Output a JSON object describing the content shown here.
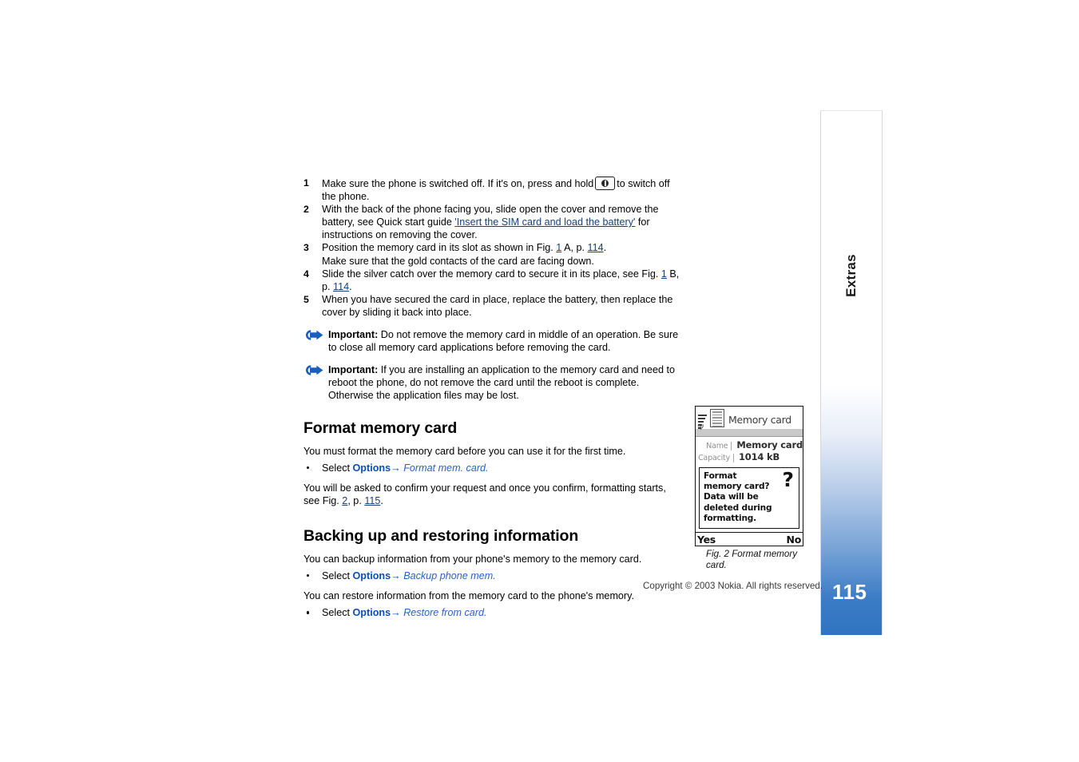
{
  "page": {
    "copyright": "Copyright © 2003 Nokia. All rights reserved."
  },
  "sidebar": {
    "chapter_label": "Extras",
    "page_number": "115",
    "accent_color": "#2f74c0"
  },
  "steps": [
    {
      "number": "1",
      "text_before_key": "Make sure the phone is switched off. If it's on, press and hold",
      "key_icon": "power-key-icon",
      "text_after_key": "to switch off the phone."
    },
    {
      "number": "2",
      "part1": "With the back of the phone facing you, slide open the cover and remove the battery, see Quick start guide ",
      "link": "'Insert the SIM card and load the battery'",
      "part2": " for instructions on removing the cover."
    },
    {
      "number": "3",
      "part1": "Position the memory card in its slot as shown in Fig. ",
      "fig_link": "1",
      "part2": " A, p. ",
      "page_link": "114",
      "part3": ".",
      "subline": "Make sure that the gold contacts of the card are facing down."
    },
    {
      "number": "4",
      "part1": "Slide the silver catch over the memory card to secure it in its place, see Fig. ",
      "fig_link": "1",
      "part2": " B, p. ",
      "page_link": "114",
      "part3": "."
    },
    {
      "number": "5",
      "part1": "When you have secured the card in place, replace the battery, then replace the cover by sliding it back into place."
    }
  ],
  "notes": [
    {
      "icon": "important-arrow-icon",
      "label": "Important:",
      "text": " Do not remove the memory card in middle of an operation. Be sure to close all memory card applications before removing the card."
    },
    {
      "icon": "important-arrow-icon",
      "label": "Important:",
      "text": " If you are installing an application to the memory card and need to reboot the phone, do not remove the card until the reboot is complete. Otherwise the application files may be lost."
    }
  ],
  "section_format": {
    "heading": "Format memory card",
    "intro": "You must format the memory card before you can use it for the first time.",
    "bullet": {
      "select_word": "Select",
      "menu": "Options",
      "arrow": "→",
      "command": "Format mem. card."
    },
    "outro_part1": "You will be asked to confirm your request and once you confirm, formatting starts, see Fig. ",
    "outro_fig_link": "2",
    "outro_part2": ", p. ",
    "outro_page_link": "115",
    "outro_part3": "."
  },
  "section_backup": {
    "heading": "Backing up and restoring information",
    "intro_backup": "You can backup information from your phone's memory to the memory card.",
    "bullet_backup": {
      "select_word": "Select",
      "menu": "Options",
      "arrow": "→",
      "command": "Backup phone mem."
    },
    "intro_restore": "You can restore information from the memory card to the phone's memory.",
    "bullet_restore": {
      "select_word": "Select",
      "menu": "Options",
      "arrow": "→",
      "command": "Restore from card."
    }
  },
  "figure": {
    "caption": "Fig. 2 Format memory card.",
    "screen": {
      "title": "Memory card",
      "title_icon": "memory-card-icon",
      "signal_icon": "signal-strength-icon",
      "antenna_icon": "antenna-icon",
      "fields": [
        {
          "label": "Name",
          "value": "Memory card"
        },
        {
          "label": "Capacity",
          "value": "1014 kB"
        }
      ],
      "dialog": {
        "text": "Format memory card? Data will be deleted during formatting.",
        "icon": "question-mark-icon"
      },
      "softkey_left": "Yes",
      "softkey_right": "No"
    }
  }
}
